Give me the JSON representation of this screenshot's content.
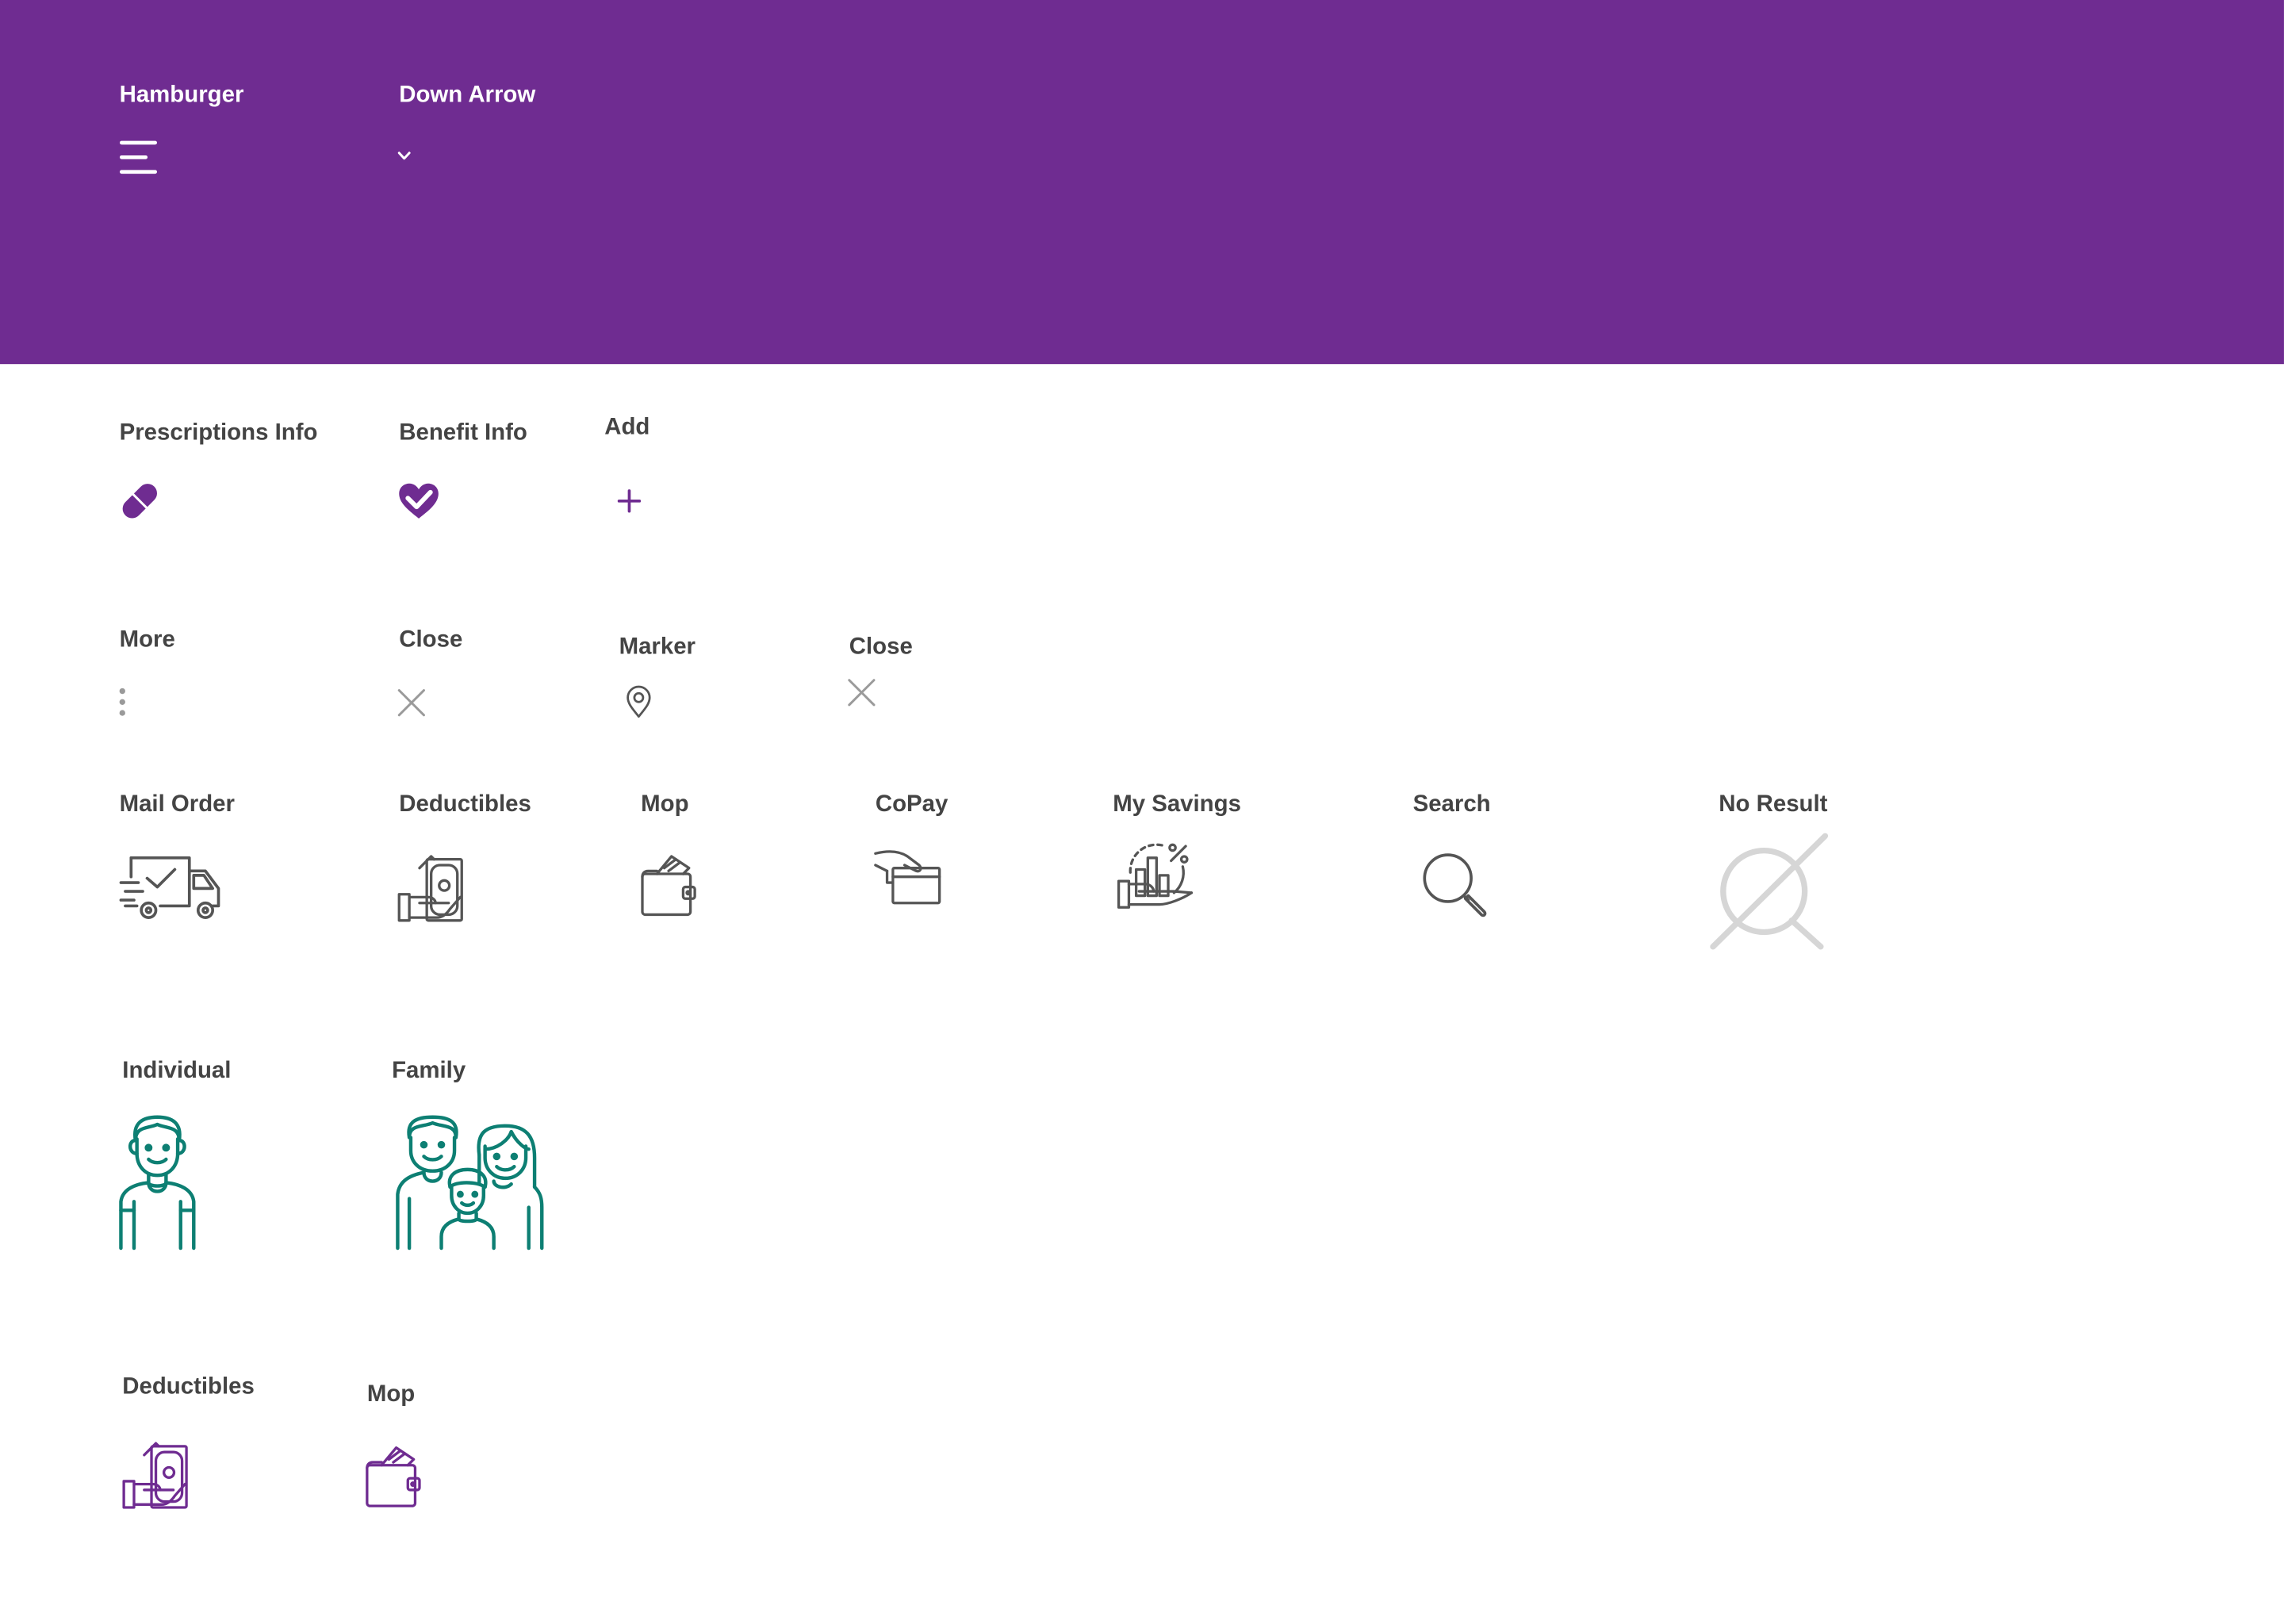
{
  "colors": {
    "header_bg": "#6f2c91",
    "header_text": "#ffffff",
    "label_text": "#444444",
    "purple": "#6f2c91",
    "gray_icon": "#555555",
    "light_gray_icon": "#9a9a9a",
    "pale_gray_icon": "#d6d6d6",
    "teal": "#0d7f73"
  },
  "header": {
    "items": [
      {
        "label": "Hamburger",
        "icon": "hamburger-menu-icon"
      },
      {
        "label": "Down Arrow",
        "icon": "chevron-down-icon"
      }
    ]
  },
  "rows": {
    "actions": [
      {
        "label": "Prescriptions Info",
        "icon": "pill-icon"
      },
      {
        "label": "Benefit Info",
        "icon": "heart-check-icon"
      },
      {
        "label": "Add",
        "icon": "plus-icon"
      }
    ],
    "utilities": [
      {
        "label": "More",
        "icon": "more-vertical-icon"
      },
      {
        "label": "Close",
        "icon": "close-icon"
      },
      {
        "label": "Marker",
        "icon": "map-marker-icon"
      },
      {
        "label": "Close",
        "icon": "close-icon"
      }
    ],
    "features": [
      {
        "label": "Mail Order",
        "icon": "delivery-truck-icon"
      },
      {
        "label": "Deductibles",
        "icon": "cash-hand-icon"
      },
      {
        "label": "Mop",
        "icon": "wallet-card-icon"
      },
      {
        "label": "CoPay",
        "icon": "hand-card-icon"
      },
      {
        "label": "My Savings",
        "icon": "savings-chart-hand-icon"
      },
      {
        "label": "Search",
        "icon": "magnifier-icon"
      },
      {
        "label": "No Result",
        "icon": "no-result-icon"
      }
    ],
    "members": [
      {
        "label": "Individual",
        "icon": "person-icon"
      },
      {
        "label": "Family",
        "icon": "family-icon"
      }
    ],
    "purple_variants": [
      {
        "label": "Deductibles",
        "icon": "cash-hand-icon"
      },
      {
        "label": "Mop",
        "icon": "wallet-card-icon"
      }
    ]
  }
}
